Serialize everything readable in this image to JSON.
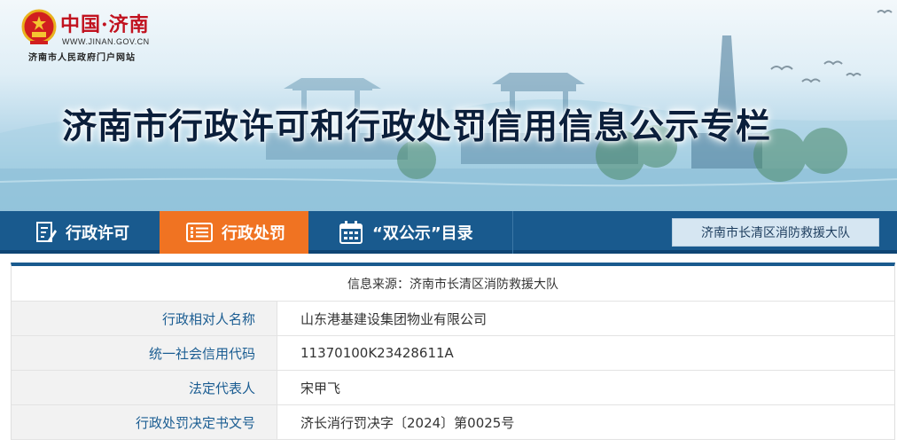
{
  "header": {
    "logo_text": "中国·济南",
    "logo_url": "WWW.JINAN.GOV.CN",
    "logo_subtitle": "济南市人民政府门户网站",
    "banner_title": "济南市行政许可和行政处罚信用信息公示专栏"
  },
  "nav": {
    "items": [
      {
        "label": "行政许可",
        "icon": "edit-doc-icon",
        "active": false
      },
      {
        "label": "行政处罚",
        "icon": "list-icon",
        "active": true
      },
      {
        "label": "“双公示”目录",
        "icon": "calendar-icon",
        "active": false
      }
    ],
    "department": "济南市长清区消防救援大队"
  },
  "record": {
    "info_source": "信息来源：济南市长清区消防救援大队",
    "fields": [
      {
        "label": "行政相对人名称",
        "value": "山东港基建设集团物业有限公司"
      },
      {
        "label": "统一社会信用代码",
        "value": "11370100K23428611A"
      },
      {
        "label": "法定代表人",
        "value": "宋甲飞"
      },
      {
        "label": "行政处罚决定书文号",
        "value": "济长消行罚决字〔2024〕第0025号"
      }
    ]
  },
  "colors": {
    "nav_bg": "#195a8e",
    "nav_active": "#f07322",
    "label_text": "#1b5d92",
    "title_text": "#0b1f3b"
  }
}
